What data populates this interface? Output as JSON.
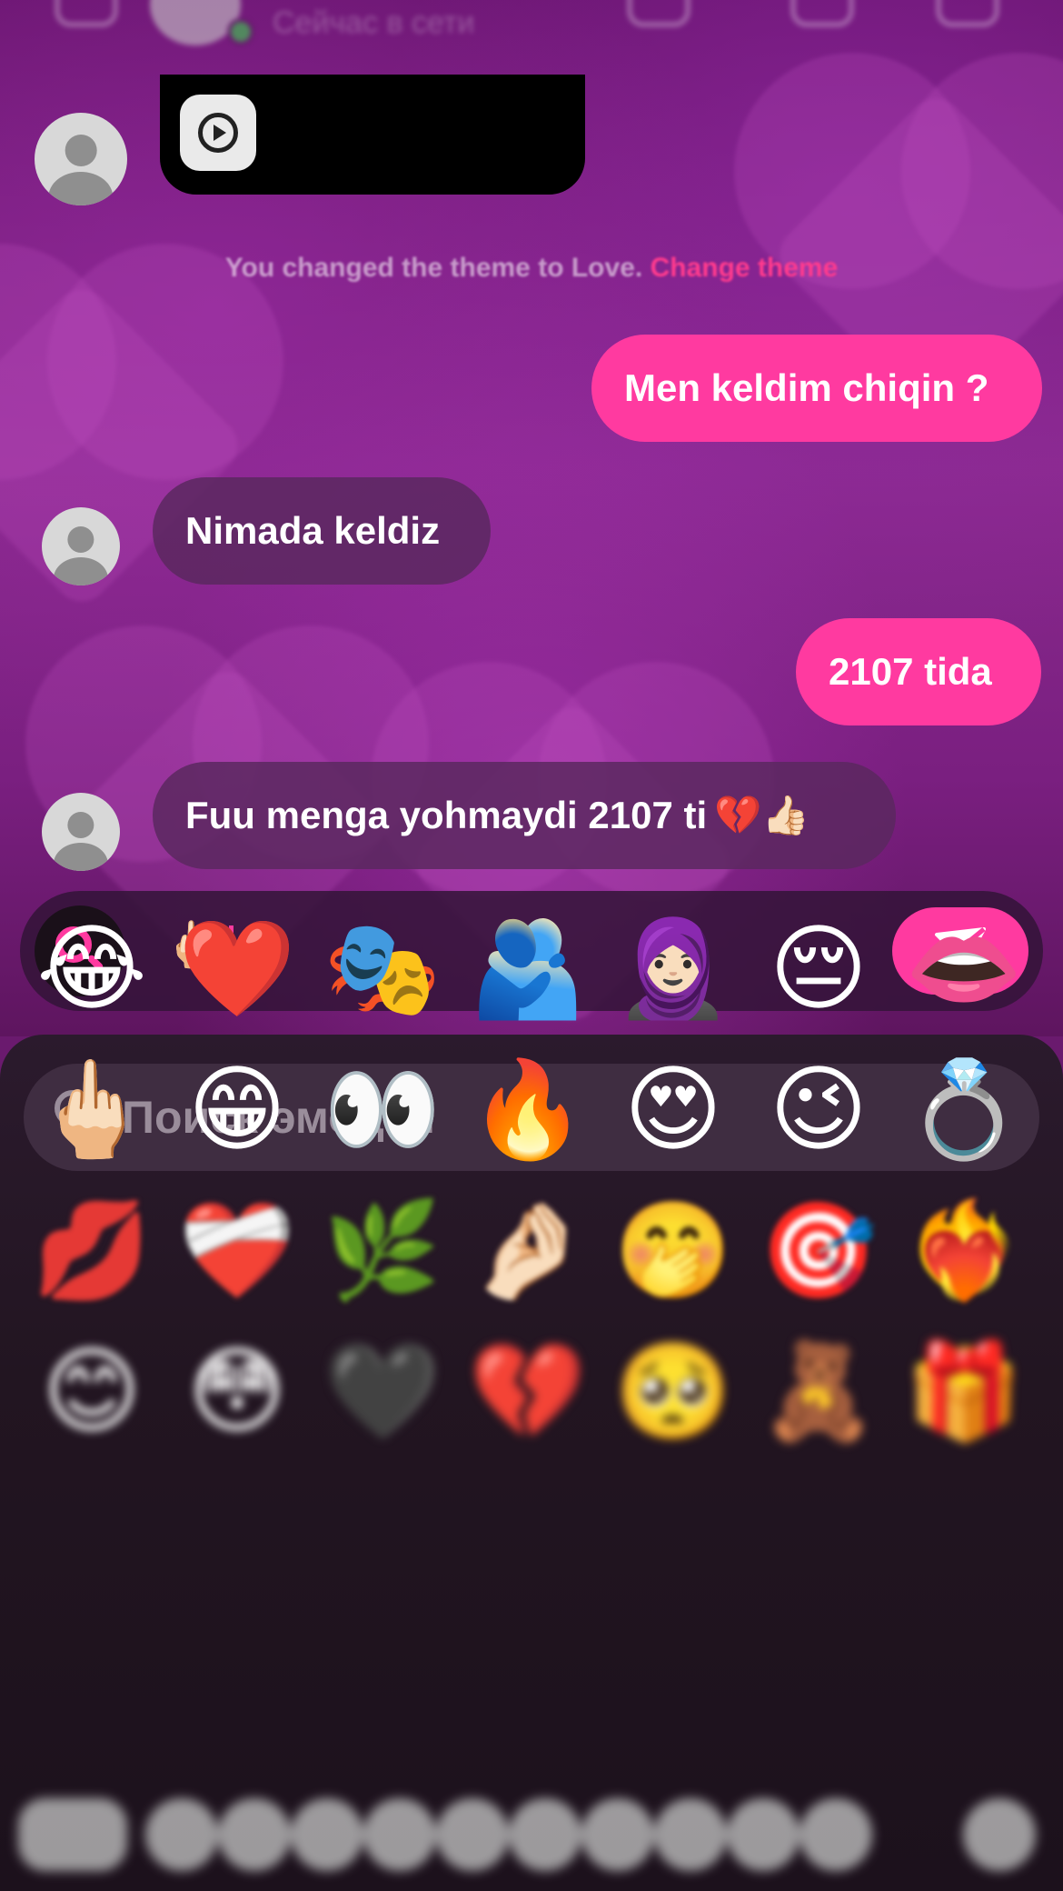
{
  "header": {
    "status_text": "Сейчас в сети"
  },
  "notice": {
    "text": "You changed the theme to Love.",
    "link": "Change theme"
  },
  "messages": [
    {
      "direction": "out",
      "text": "Men keldim chiqin ?"
    },
    {
      "direction": "in",
      "text": "Nimada keldiz"
    },
    {
      "direction": "out",
      "text": "2107 tida"
    },
    {
      "direction": "in",
      "text": "Fuu menga yohmaydi 2107 ti",
      "emoji": "💔👍🏻"
    }
  ],
  "composer": {
    "value": "🖕🏻"
  },
  "emoji_search": {
    "placeholder": "Поиск эмодзи"
  },
  "emojis": {
    "row1": [
      "😂",
      "❤️",
      "🎭",
      "🫂",
      "🧕🏻",
      "😔",
      "👄"
    ],
    "row2": [
      "🖕🏻",
      "😁",
      "👀",
      "🔥",
      "😍",
      "😉",
      "💍"
    ],
    "row3": [
      "💋",
      "❤️‍🩹",
      "🌿",
      "🤌🏻",
      "🤭",
      "🎯",
      "❤️‍🔥"
    ],
    "row4": [
      "😊",
      "😳",
      "🖤",
      "💔",
      "🥺",
      "🧸",
      "🎁"
    ]
  },
  "colors": {
    "accent": "#ff3aa0",
    "chat_bg": "#7a1f80",
    "incoming_bubble": "#5a285f",
    "panel_bg": "#221521"
  }
}
